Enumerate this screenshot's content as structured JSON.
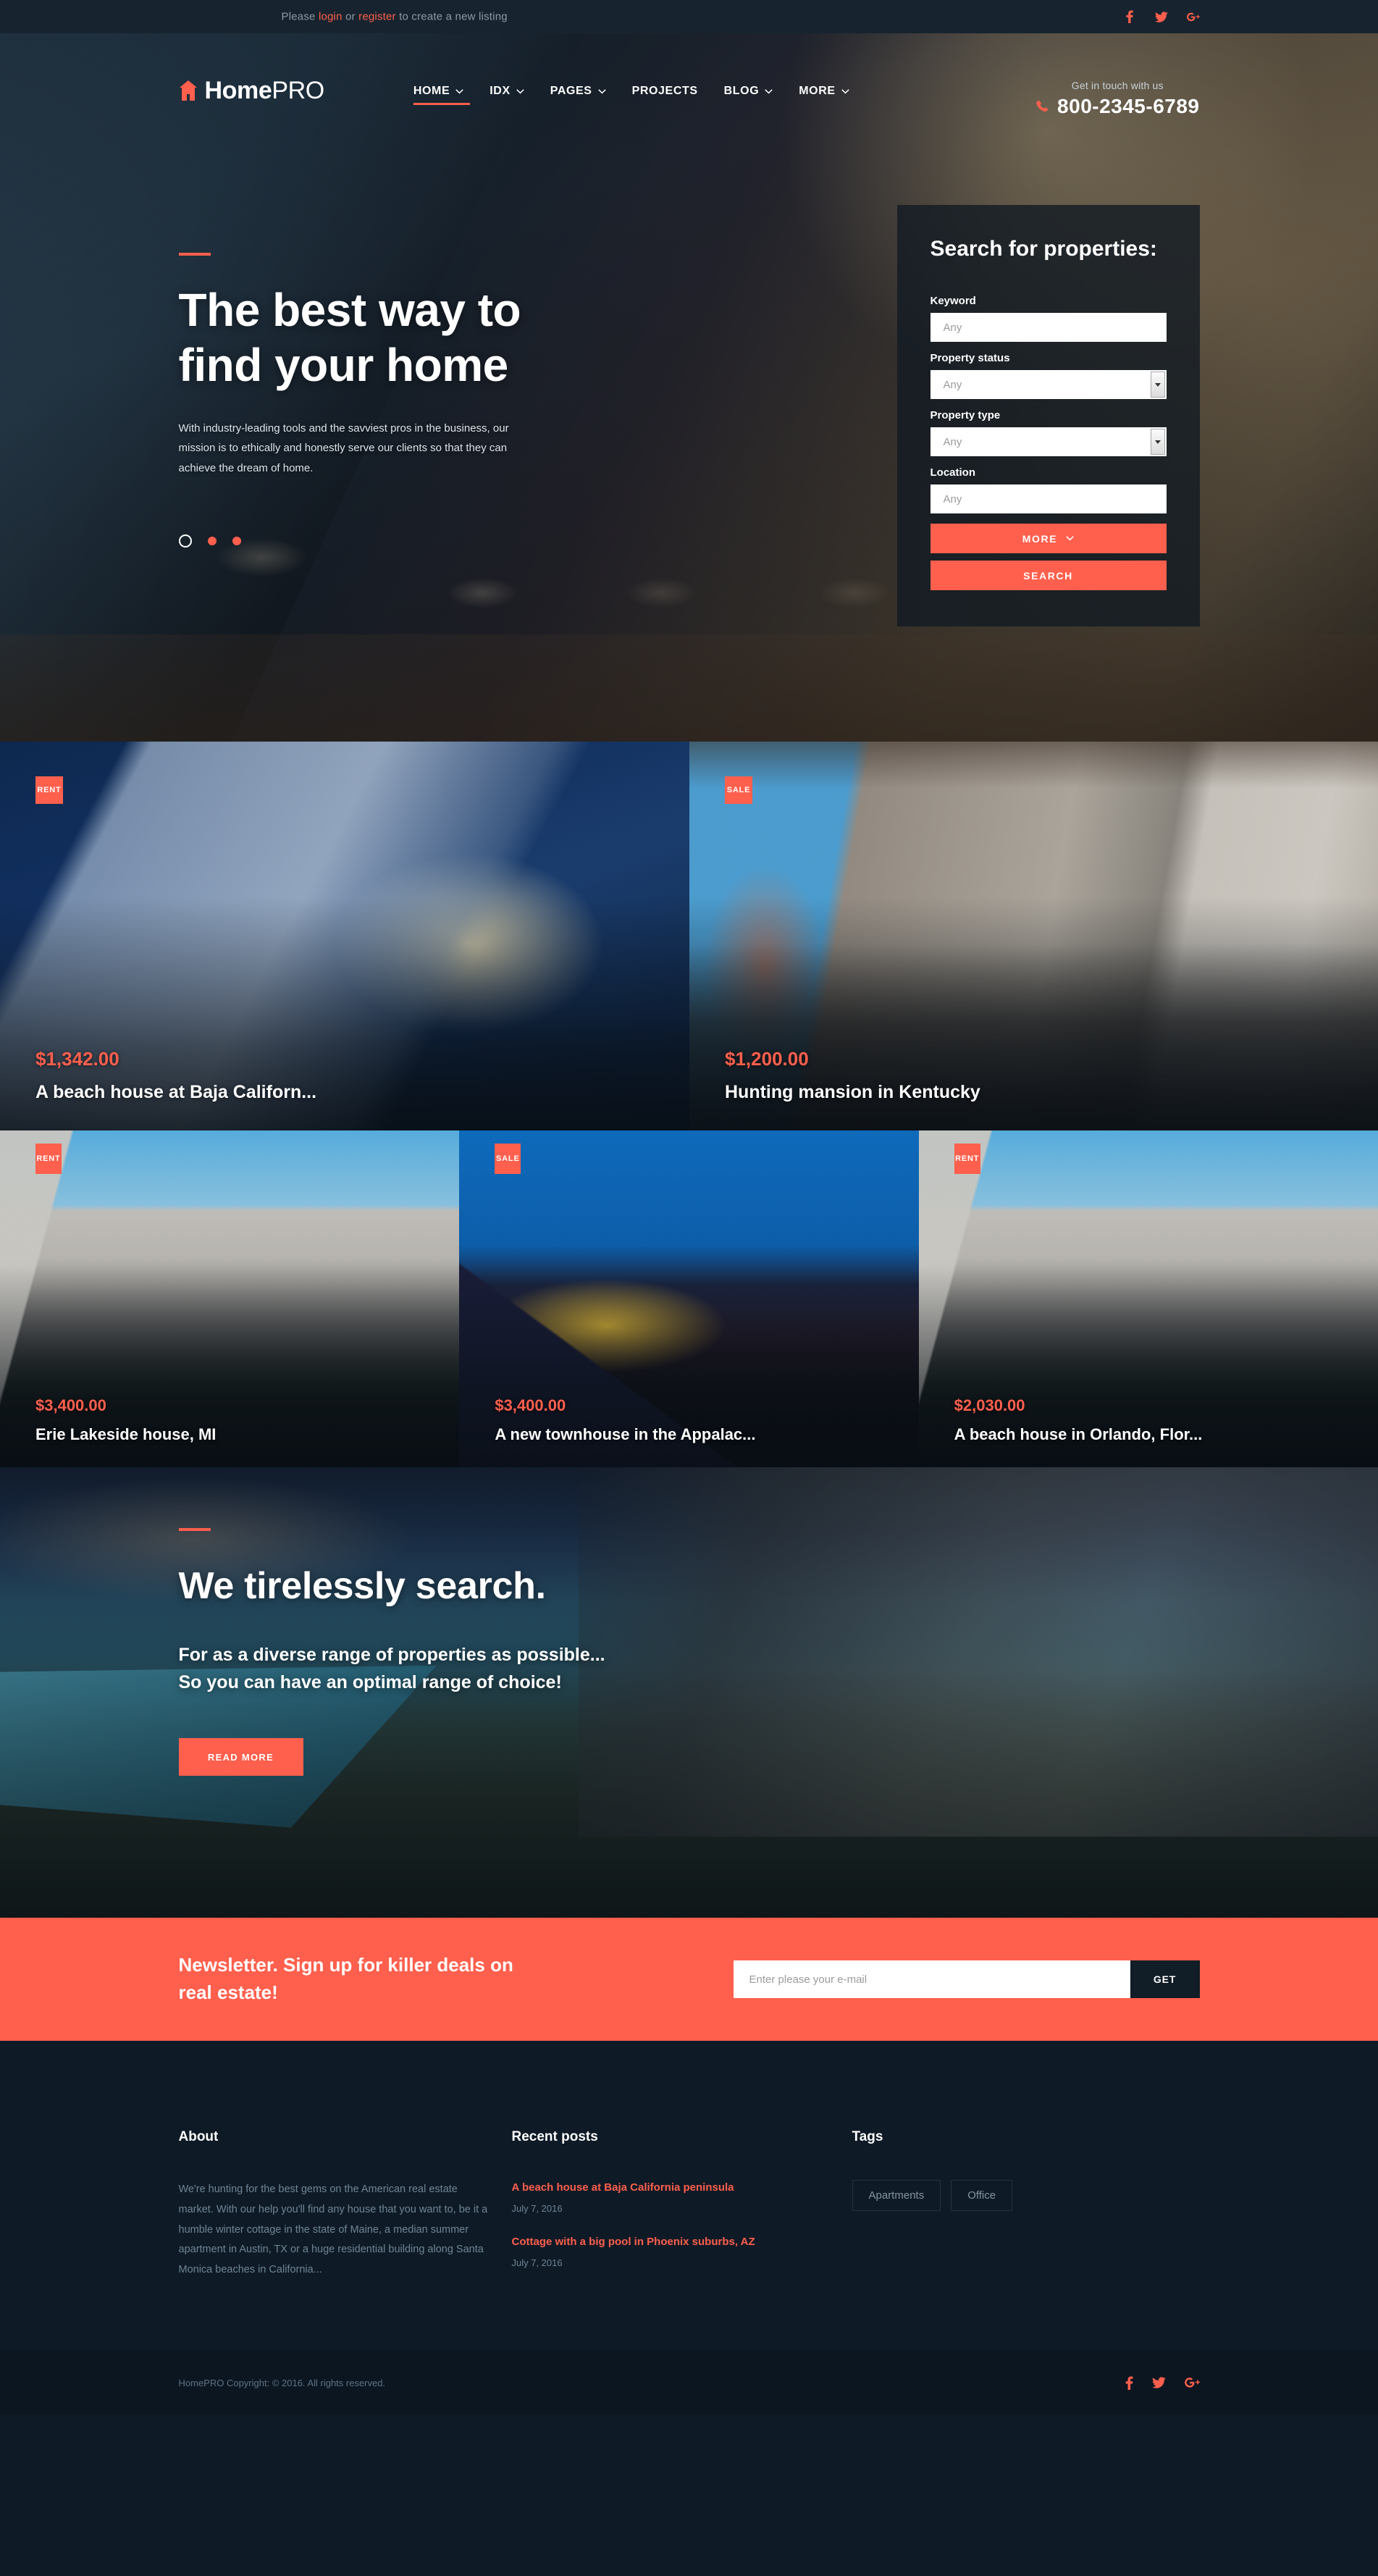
{
  "topbar": {
    "note_prefix": "Please ",
    "login_label": "login",
    "note_mid": " or ",
    "register_label": "register",
    "note_suffix": " to create a new listing",
    "social": [
      {
        "name": "facebook-icon",
        "label": "f"
      },
      {
        "name": "twitter-icon",
        "label": "t"
      },
      {
        "name": "google-plus-icon",
        "label": "G+"
      }
    ]
  },
  "header": {
    "logo_home": "Home",
    "logo_pro": "PRO",
    "nav": [
      {
        "label": "HOME",
        "has_caret": true,
        "active": true
      },
      {
        "label": "IDX",
        "has_caret": true,
        "active": false
      },
      {
        "label": "PAGES",
        "has_caret": true,
        "active": false
      },
      {
        "label": "PROJECTS",
        "has_caret": false,
        "active": false
      },
      {
        "label": "BLOG",
        "has_caret": true,
        "active": false
      },
      {
        "label": "MORE",
        "has_caret": true,
        "active": false
      }
    ],
    "contact_label": "Get in touch with us",
    "phone": "800-2345-6789"
  },
  "hero": {
    "title_line1": "The best way to",
    "title_line2": "find your home",
    "subtitle": "With industry-leading tools and the savviest pros in the business, our mission is to ethically and honestly serve our clients so that they can achieve the dream of home.",
    "slider_dots": 3,
    "active_dot": 0
  },
  "search_panel": {
    "title": "Search for properties:",
    "keyword_label": "Keyword",
    "keyword_placeholder": "Any",
    "status_label": "Property status",
    "status_value": "Any",
    "type_label": "Property type",
    "type_value": "Any",
    "location_label": "Location",
    "location_placeholder": "Any",
    "more_label": "MORE",
    "search_label": "SEARCH"
  },
  "properties_row1": [
    {
      "badge": "RENT",
      "price": "$1,342.00",
      "name": "A beach house at Baja Californ...",
      "img": "img-night-house"
    },
    {
      "badge": "SALE",
      "price": "$1,200.00",
      "name": "Hunting mansion in Kentucky",
      "img": "img-kitchen"
    }
  ],
  "properties_row2": [
    {
      "badge": "RENT",
      "price": "$3,400.00",
      "name": "Erie Lakeside house, MI",
      "img": "img-lakeside"
    },
    {
      "badge": "SALE",
      "price": "$3,400.00",
      "name": "A new townhouse in the Appalac...",
      "img": "img-townhouse"
    },
    {
      "badge": "RENT",
      "price": "$2,030.00",
      "name": "A beach house in Orlando, Flor...",
      "img": "img-lakeside"
    }
  ],
  "tireless": {
    "title": "We tirelessly search.",
    "sub_line1": "For as a diverse range of properties as possible...",
    "sub_line2": "So you can have an optimal range of choice!",
    "button_label": "READ MORE"
  },
  "newsletter": {
    "title_line1": "Newsletter. Sign up for killer deals on",
    "title_line2": "real estate!",
    "input_placeholder": "Enter please your e-mail",
    "button_label": "GET"
  },
  "footer": {
    "about_title": "About",
    "about_text": "We're hunting for the best gems on the American real estate market. With our help you'll find any house that you want to, be it a humble winter cottage in the state of Maine, a median summer apartment in Austin, TX or a huge residential building along Santa Monica beaches in California...",
    "posts_title": "Recent posts",
    "posts": [
      {
        "title": "A beach house at Baja California peninsula",
        "date": "July 7, 2016"
      },
      {
        "title": "Cottage with a big pool in Phoenix suburbs, AZ",
        "date": "July 7, 2016"
      }
    ],
    "tags_title": "Tags",
    "tags": [
      "Apartments",
      "Office"
    ]
  },
  "bottombar": {
    "copyright": "HomePRO Copyright: © 2016. All rights reserved.",
    "social": [
      {
        "name": "facebook-icon"
      },
      {
        "name": "twitter-icon"
      },
      {
        "name": "google-plus-icon"
      }
    ]
  },
  "colors": {
    "accent": "#ff5f4d",
    "dark": "#0e1a26",
    "darker": "#0b1621",
    "topbar": "#17242f"
  }
}
